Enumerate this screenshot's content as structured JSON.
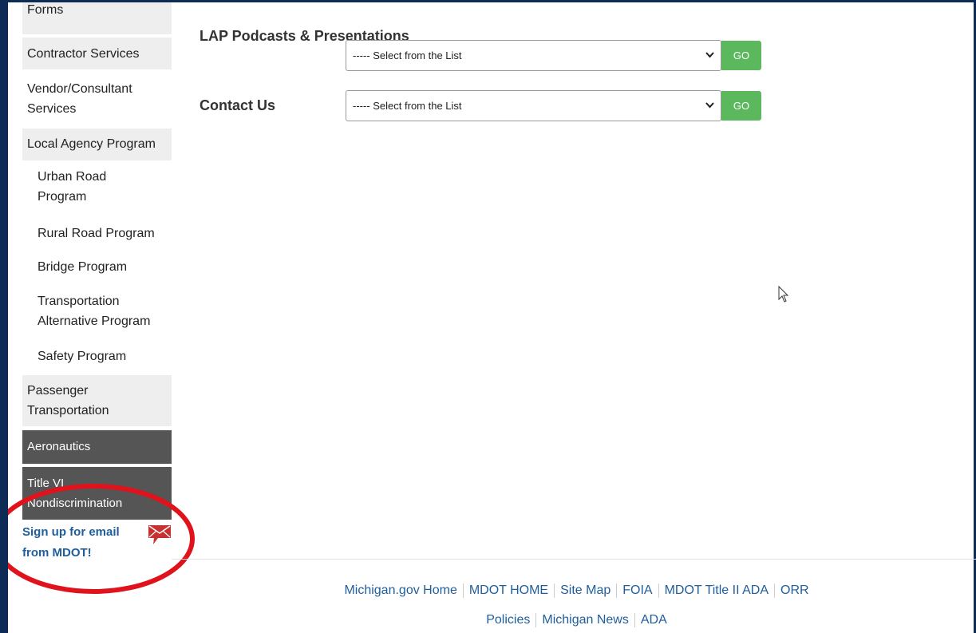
{
  "sidebar": {
    "items": [
      {
        "label": "Forms"
      },
      {
        "label": "Contractor Services"
      },
      {
        "label": "Vendor/Consultant Services"
      },
      {
        "label": "Local Agency Program"
      },
      {
        "label": "Urban Road Program"
      },
      {
        "label": "Rural Road Program"
      },
      {
        "label": "Bridge Program"
      },
      {
        "label": "Transportation Alternative Program"
      },
      {
        "label": "Safety Program"
      },
      {
        "label": "Passenger Transportation"
      },
      {
        "label": "Aeronautics"
      },
      {
        "label": "Title VI Nondiscrimination"
      }
    ],
    "email_signup": "Sign up for email from MDOT!"
  },
  "main": {
    "rows": [
      {
        "label": "LAP Podcasts & Presentations",
        "select_value": "----- Select from the List",
        "button": "GO"
      },
      {
        "label": "Contact Us",
        "select_value": "----- Select from the List",
        "button": "GO"
      }
    ]
  },
  "footer": {
    "line1": [
      "Michigan.gov Home",
      "MDOT HOME",
      "Site Map",
      "FOIA",
      "MDOT Title II ADA",
      "ORR"
    ],
    "line2": [
      "Policies",
      "Michigan News",
      "ADA"
    ]
  },
  "colors": {
    "frame": "#0d2b55",
    "go_button": "#5cb85c",
    "link": "#1f5e9c",
    "nav_dark": "#555555",
    "nav_light": "#eeeeee",
    "annotation": "#e0121b"
  },
  "icons": [
    "email-envelope-icon",
    "chevron-down-icon",
    "mouse-cursor-icon"
  ]
}
